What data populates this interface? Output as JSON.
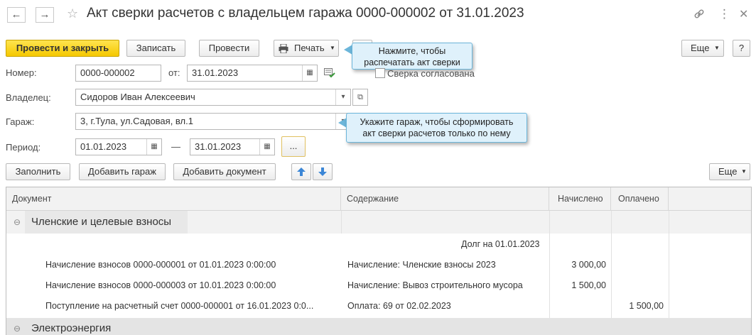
{
  "window": {
    "title": "Акт сверки расчетов с владельцем гаража 0000-000002 от 31.01.2023",
    "back_arrow": "←",
    "forward_arrow": "→",
    "star": "☆",
    "link_icon": "link-icon",
    "menu_icon": "⋮",
    "close_icon": "✕"
  },
  "toolbar": {
    "post_close": "Провести и закрыть",
    "save": "Записать",
    "post": "Провести",
    "print": "Печать",
    "more": "Еще",
    "help": "?"
  },
  "tooltips": {
    "print": "Нажмите, чтобы распечатать акт сверки",
    "garage": "Укажите гараж, чтобы сформировать акт сверки расчетов только по нему"
  },
  "form": {
    "number_label": "Номер:",
    "number_value": "0000-000002",
    "date_label": "от:",
    "date_value": "31.01.2023",
    "reconciled_label": "Сверка согласована",
    "reconciled_checked": false,
    "owner_label": "Владелец:",
    "owner_value": "Сидоров Иван Алексеевич",
    "garage_label": "Гараж:",
    "garage_value": "3, г.Тула, ул.Садовая, вл.1",
    "period_label": "Период:",
    "period_from": "01.01.2023",
    "period_dash": "—",
    "period_to": "31.01.2023",
    "period_select": "..."
  },
  "table_toolbar": {
    "fill": "Заполнить",
    "add_garage": "Добавить гараж",
    "add_document": "Добавить документ",
    "more": "Еще"
  },
  "table": {
    "headers": [
      "Документ",
      "Содержание",
      "Начислено",
      "Оплачено"
    ],
    "group1": "Членские и целевые взносы",
    "debt_label": "Долг на 01.01.2023",
    "rows": [
      {
        "doc": "Начисление взносов 0000-000001 от 01.01.2023 0:00:00",
        "content": "Начисление: Членские взносы 2023",
        "charged": "3 000,00",
        "paid": ""
      },
      {
        "doc": "Начисление взносов 0000-000003 от 10.01.2023 0:00:00",
        "content": "Начисление: Вывоз строительного мусора",
        "charged": "1 500,00",
        "paid": ""
      },
      {
        "doc": "Поступление на расчетный счет 0000-000001 от 16.01.2023 0:0...",
        "content": "Оплата: 69 от 02.02.2023",
        "charged": "",
        "paid": "1 500,00"
      }
    ],
    "group2": "Электроэнергия"
  },
  "colors": {
    "primary": "#f5c800",
    "tooltip_bg": "#dff1fb",
    "tooltip_border": "#6cb6da",
    "arrow_blue": "#4a90d9"
  }
}
